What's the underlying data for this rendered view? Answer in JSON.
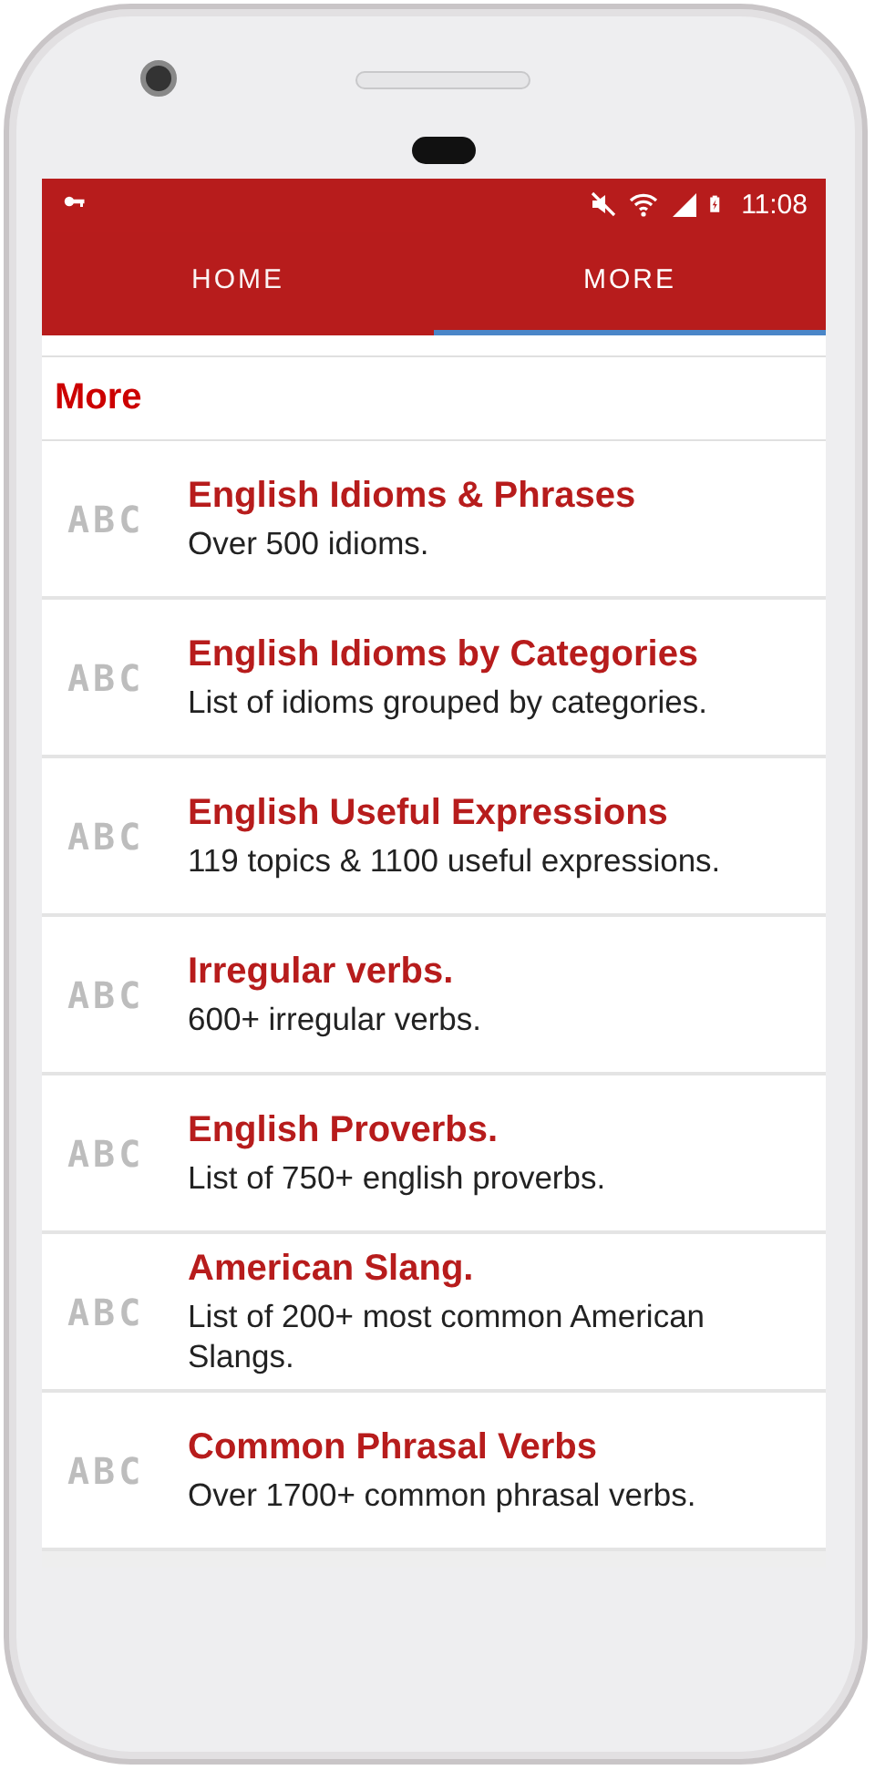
{
  "status_bar": {
    "time": "11:08"
  },
  "tabs": [
    {
      "label": "HOME",
      "selected": false
    },
    {
      "label": "MORE",
      "selected": true
    }
  ],
  "section": {
    "title": "More"
  },
  "items": [
    {
      "badge": "ABC",
      "title": "English Idioms & Phrases",
      "subtitle": "Over 500 idioms."
    },
    {
      "badge": "ABC",
      "title": "English Idioms by Categories",
      "subtitle": "List of idioms grouped by categories."
    },
    {
      "badge": "ABC",
      "title": "English Useful Expressions",
      "subtitle": "119 topics & 1100 useful expressions."
    },
    {
      "badge": "ABC",
      "title": "Irregular verbs.",
      "subtitle": "600+ irregular verbs."
    },
    {
      "badge": "ABC",
      "title": "English Proverbs.",
      "subtitle": "List of 750+ english proverbs."
    },
    {
      "badge": "ABC",
      "title": "American Slang.",
      "subtitle": "List of 200+ most common American Slangs."
    },
    {
      "badge": "ABC",
      "title": "Common Phrasal Verbs",
      "subtitle": "Over 1700+ common phrasal verbs."
    }
  ]
}
